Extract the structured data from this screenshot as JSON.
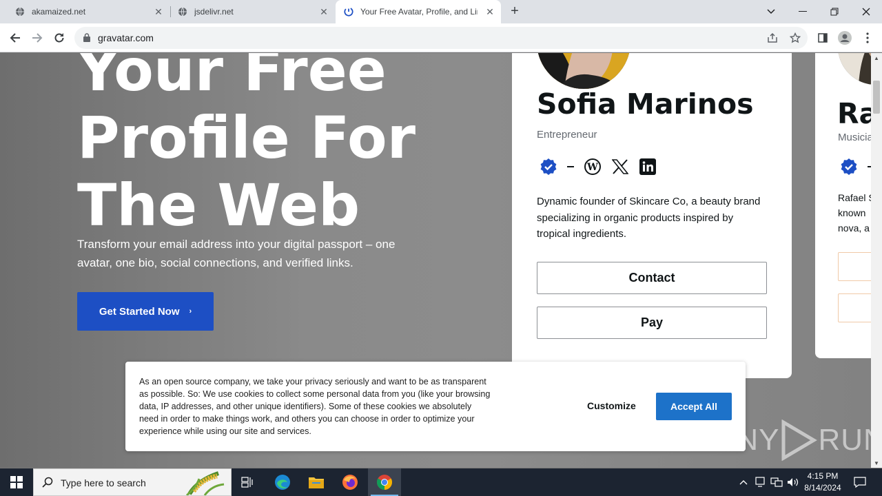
{
  "browser": {
    "tabs": [
      {
        "title": "akamaized.net",
        "active": false
      },
      {
        "title": "jsdelivr.net",
        "active": false
      },
      {
        "title": "Your Free Avatar, Profile, and Lin",
        "active": true
      }
    ],
    "new_tab_symbol": "+",
    "url": "gravatar.com"
  },
  "hero": {
    "title_line1": "Your Free",
    "title_line2": "Profile For",
    "title_line3": "The Web",
    "subtitle": "Transform your email address into your digital passport – one avatar, one bio, social connections, and verified links.",
    "cta_label": "Get Started Now",
    "cta_arrow": "›"
  },
  "profile_card": {
    "name": "Sofia Marinos",
    "role": "Entrepreneur",
    "bio": "Dynamic founder of Skincare Co, a beauty brand specializing in organic products inspired by tropical ingredients.",
    "contact_label": "Contact",
    "pay_label": "Pay",
    "socials": [
      "verified-badge-icon",
      "wordpress-icon",
      "x-icon",
      "linkedin-icon"
    ]
  },
  "profile_card_2": {
    "name": "Ra",
    "role": "Musicia",
    "bio_line1": "Rafael S",
    "bio_line2": "known",
    "bio_line3": "nova, a"
  },
  "cookie_banner": {
    "text": "As an open source company, we take your privacy seriously and want to be as transparent as possible. So: We use cookies to collect some personal data from you (like your browsing data, IP addresses, and other unique identifiers). Some of these cookies we absolutely need in order to make things work, and others you can choose in order to optimize your experience while using our site and services.",
    "customize_label": "Customize",
    "accept_label": "Accept All"
  },
  "watermark": {
    "left": "ANY",
    "right": "RUN"
  },
  "taskbar": {
    "search_placeholder": "Type here to search",
    "time": "4:15 PM",
    "date": "8/14/2024"
  },
  "colors": {
    "cta": "#1d4fc4",
    "accept": "#1d72c9",
    "verified": "#1d4fc4",
    "taskbar": "#1c2431"
  }
}
